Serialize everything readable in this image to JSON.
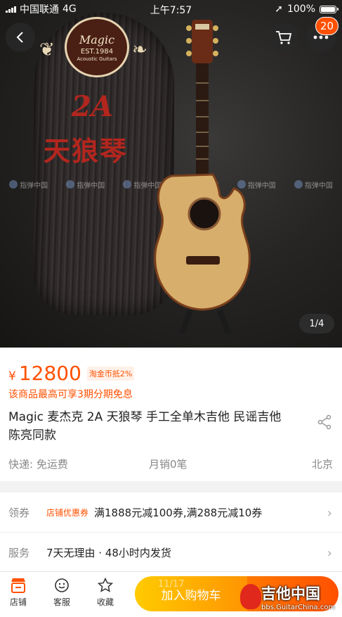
{
  "status_bar": {
    "carrier": "中国联通",
    "network": "4G",
    "time": "上午7:57",
    "battery": "100%",
    "battery_level": 1.0
  },
  "hero": {
    "logo_brand": "Magic",
    "logo_est": "EST.1984",
    "logo_sub": "Acoustic Guitars",
    "model_code": "2A",
    "model_name": "天狼琴",
    "watermark": "指弹中国",
    "pager": "1/4",
    "cart_badge": "20"
  },
  "product": {
    "currency": "¥",
    "price": "12800",
    "coin_tag": "淘金币抵2%",
    "installment": "该商品最高可享3期分期免息",
    "title": "Magic 麦杰克 2A 天狼琴 手工全单木吉他 民谣吉他 陈亮同款",
    "shipping": "快递: 免运费",
    "monthly_sales": "月销0笔",
    "location": "北京"
  },
  "coupon_row": {
    "label": "领券",
    "tag": "店铺优惠券",
    "text": "满1888元减100券,满288元减10券"
  },
  "service_row": {
    "label": "服务",
    "text": "7天无理由 · 48小时内发货"
  },
  "bottom_bar": {
    "shop": "店铺",
    "service": "客服",
    "favorite": "收藏",
    "add_to_cart": "加入购物车",
    "progress": "11/17",
    "site_name": "吉他中国",
    "site_url": "bbs.GuitarChina.com"
  },
  "colors": {
    "accent": "#ff5000",
    "cart_start": "#ffcb00",
    "cart_end": "#ff9402"
  }
}
